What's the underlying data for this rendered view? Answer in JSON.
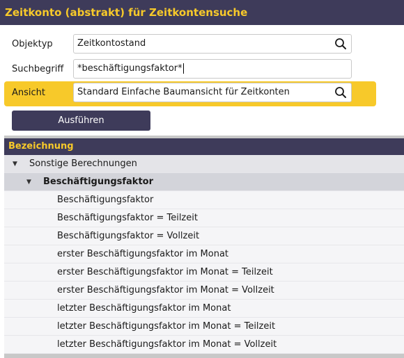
{
  "window": {
    "title": "Zeitkonto (abstrakt) für Zeitkontensuche"
  },
  "form": {
    "objekttyp_label": "Objektyp",
    "objekttyp_value": "Zeitkontostand",
    "suchbegriff_label": "Suchbegriff",
    "suchbegriff_value": "*beschäftigungsfaktor*",
    "ansicht_label": "Ansicht",
    "ansicht_value": "Standard Einfache Baumansicht für Zeitkonten",
    "execute_label": "Ausführen"
  },
  "table": {
    "header": "Bezeichnung",
    "group1": "Sonstige Berechnungen",
    "group2": "Beschäftigungsfaktor",
    "items": [
      "Beschäftigungsfaktor",
      "Beschäftigungsfaktor = Teilzeit",
      "Beschäftigungsfaktor = Vollzeit",
      "erster Beschäftigungsfaktor im Monat",
      "erster Beschäftigungsfaktor im Monat = Teilzeit",
      "erster Beschäftigungsfaktor im Monat = Vollzeit",
      "letzter Beschäftigungsfaktor im Monat",
      "letzter Beschäftigungsfaktor im Monat = Teilzeit",
      "letzter Beschäftigungsfaktor im Monat = Vollzeit"
    ]
  },
  "icons": {
    "search": "search-icon",
    "expand": "caret-down-icon"
  },
  "colors": {
    "brand_dark": "#3e3b5a",
    "accent_yellow": "#f7c92a"
  }
}
